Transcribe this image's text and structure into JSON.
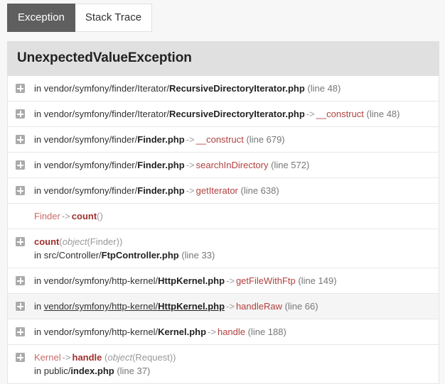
{
  "tabs": [
    {
      "label": "Exception",
      "name": "tab-exception",
      "active": true
    },
    {
      "label": "Stack Trace",
      "name": "tab-stack-trace",
      "active": false
    }
  ],
  "exception": {
    "title": "UnexpectedValueException"
  },
  "colors": {
    "tab_active_bg": "#5f5f5f",
    "title_bg": "#e0e0e0",
    "method": "#b0413e",
    "class": "#c96a69",
    "page_bg": "#f7f7f7",
    "row_highlight": "#f5f5f5"
  },
  "icons": {
    "toggle": "plus-square-icon"
  },
  "trace": [
    {
      "id": "trace-row-1",
      "toggle": true,
      "highlight": false,
      "lines": [
        [
          {
            "t": "dim",
            "v": "in "
          },
          {
            "t": "path",
            "v": "vendor/symfony/finder/Iterator/"
          },
          {
            "t": "file",
            "v": "RecursiveDirectoryIterator.php"
          },
          {
            "t": "line",
            "v": " (line 48)"
          }
        ]
      ]
    },
    {
      "id": "trace-row-2",
      "toggle": true,
      "highlight": false,
      "lines": [
        [
          {
            "t": "dim",
            "v": "in "
          },
          {
            "t": "path",
            "v": "vendor/symfony/finder/Iterator/"
          },
          {
            "t": "file",
            "v": "RecursiveDirectoryIterator.php"
          },
          {
            "t": "arrow",
            "v": "->"
          },
          {
            "t": "method",
            "v": "__construct"
          },
          {
            "t": "line",
            "v": " (line 48)"
          }
        ]
      ]
    },
    {
      "id": "trace-row-3",
      "toggle": true,
      "highlight": false,
      "lines": [
        [
          {
            "t": "dim",
            "v": "in "
          },
          {
            "t": "path",
            "v": "vendor/symfony/finder/"
          },
          {
            "t": "file",
            "v": "Finder.php"
          },
          {
            "t": "arrow",
            "v": "->"
          },
          {
            "t": "method",
            "v": "__construct"
          },
          {
            "t": "line",
            "v": " (line 679)"
          }
        ]
      ]
    },
    {
      "id": "trace-row-4",
      "toggle": true,
      "highlight": false,
      "lines": [
        [
          {
            "t": "dim",
            "v": "in "
          },
          {
            "t": "path",
            "v": "vendor/symfony/finder/"
          },
          {
            "t": "file",
            "v": "Finder.php"
          },
          {
            "t": "arrow",
            "v": "->"
          },
          {
            "t": "method",
            "v": "searchInDirectory"
          },
          {
            "t": "line",
            "v": " (line 572)"
          }
        ]
      ]
    },
    {
      "id": "trace-row-5",
      "toggle": true,
      "highlight": false,
      "lines": [
        [
          {
            "t": "dim",
            "v": "in "
          },
          {
            "t": "path",
            "v": "vendor/symfony/finder/"
          },
          {
            "t": "file",
            "v": "Finder.php"
          },
          {
            "t": "arrow",
            "v": "->"
          },
          {
            "t": "method",
            "v": "getIterator"
          },
          {
            "t": "line",
            "v": " (line 638)"
          }
        ]
      ]
    },
    {
      "id": "trace-row-6",
      "toggle": false,
      "highlight": false,
      "lines": [
        [
          {
            "t": "class",
            "v": "Finder"
          },
          {
            "t": "arrow",
            "v": "->"
          },
          {
            "t": "method-b",
            "v": "count"
          },
          {
            "t": "paren",
            "v": "()"
          }
        ]
      ]
    },
    {
      "id": "trace-row-7",
      "toggle": true,
      "highlight": false,
      "lines": [
        [
          {
            "t": "method-b",
            "v": "count"
          },
          {
            "t": "paren",
            "v": "("
          },
          {
            "t": "obj",
            "v": "object"
          },
          {
            "t": "objarg",
            "v": "(Finder))"
          }
        ],
        [
          {
            "t": "dim",
            "v": "in "
          },
          {
            "t": "path",
            "v": "src/Controller/"
          },
          {
            "t": "file",
            "v": "FtpController.php"
          },
          {
            "t": "line",
            "v": " (line 33)"
          }
        ]
      ]
    },
    {
      "id": "trace-row-8",
      "toggle": true,
      "highlight": false,
      "lines": [
        [
          {
            "t": "dim",
            "v": "in "
          },
          {
            "t": "path",
            "v": "vendor/symfony/http-kernel/"
          },
          {
            "t": "file",
            "v": "HttpKernel.php"
          },
          {
            "t": "arrow",
            "v": "->"
          },
          {
            "t": "method",
            "v": "getFileWithFtp"
          },
          {
            "t": "line",
            "v": " (line 149)"
          }
        ]
      ]
    },
    {
      "id": "trace-row-9",
      "toggle": true,
      "highlight": true,
      "lines": [
        [
          {
            "t": "dim",
            "v": "in "
          },
          {
            "t": "path",
            "v": "vendor/symfony/http-kernel/",
            "u": true
          },
          {
            "t": "file",
            "v": "HttpKernel.php",
            "u": true
          },
          {
            "t": "arrow",
            "v": "->"
          },
          {
            "t": "method",
            "v": "handleRaw"
          },
          {
            "t": "line",
            "v": " (line 66)"
          }
        ]
      ]
    },
    {
      "id": "trace-row-10",
      "toggle": true,
      "highlight": false,
      "lines": [
        [
          {
            "t": "dim",
            "v": "in "
          },
          {
            "t": "path",
            "v": "vendor/symfony/http-kernel/"
          },
          {
            "t": "file",
            "v": "Kernel.php"
          },
          {
            "t": "arrow",
            "v": "->"
          },
          {
            "t": "method",
            "v": "handle"
          },
          {
            "t": "line",
            "v": " (line 188)"
          }
        ]
      ]
    },
    {
      "id": "trace-row-11",
      "toggle": true,
      "highlight": false,
      "lines": [
        [
          {
            "t": "class",
            "v": "Kernel"
          },
          {
            "t": "arrow",
            "v": "->"
          },
          {
            "t": "method-b",
            "v": "handle"
          },
          {
            "t": "paren",
            "v": " ("
          },
          {
            "t": "obj",
            "v": "object"
          },
          {
            "t": "objarg",
            "v": "(Request))"
          }
        ],
        [
          {
            "t": "dim",
            "v": "in "
          },
          {
            "t": "path",
            "v": "public/"
          },
          {
            "t": "file",
            "v": "index.php"
          },
          {
            "t": "line",
            "v": " (line 37)"
          }
        ]
      ]
    }
  ]
}
